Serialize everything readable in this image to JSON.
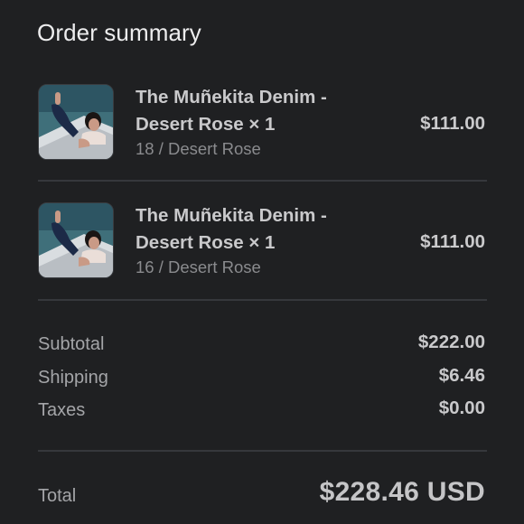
{
  "summary": {
    "title": "Order summary"
  },
  "items": [
    {
      "name": "The Muñekita Denim - Desert Rose × 1",
      "variant": "18 / Desert Rose",
      "price": "$111.00",
      "image": "product-photo"
    },
    {
      "name": "The Muñekita Denim - Desert Rose × 1",
      "variant": "16 / Desert Rose",
      "price": "$111.00",
      "image": "product-photo"
    }
  ],
  "totals": {
    "subtotal_label": "Subtotal",
    "subtotal_value": "$222.00",
    "shipping_label": "Shipping",
    "shipping_value": "$6.46",
    "taxes_label": "Taxes",
    "taxes_value": "$0.00",
    "total_label": "Total",
    "total_value": "$228.46 USD"
  },
  "colors": {
    "background": "#1f2022",
    "divider": "#36383c",
    "text_primary": "#c9c9cb",
    "text_muted": "#8a8b8e"
  }
}
